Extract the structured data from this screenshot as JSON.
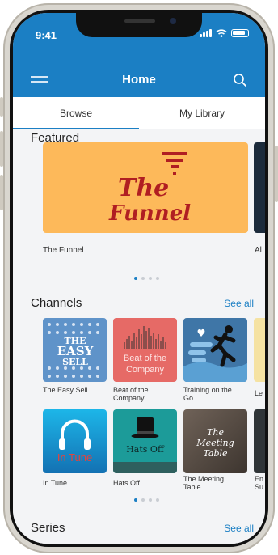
{
  "status": {
    "time": "9:41"
  },
  "header": {
    "title": "Home"
  },
  "tabs": [
    {
      "label": "Browse"
    },
    {
      "label": "My Library"
    }
  ],
  "featured": {
    "heading": "Featured",
    "items": [
      {
        "label": "The Funnel"
      },
      {
        "label": "Al"
      }
    ],
    "art": {
      "word1": "The",
      "word2": "Funnel"
    }
  },
  "channels": {
    "heading": "Channels",
    "see_all": "See all",
    "row1": [
      {
        "label": "The Easy Sell",
        "art": [
          "THE",
          "EASY",
          "SELL"
        ]
      },
      {
        "label": "Beat of the Company",
        "art": "Beat of the Company"
      },
      {
        "label": "Training on the Go"
      },
      {
        "label": "Le"
      }
    ],
    "row2": [
      {
        "label": "In Tune",
        "art": "In Tune"
      },
      {
        "label": "Hats Off",
        "art": "Hats Off"
      },
      {
        "label": "The Meeting Table",
        "art": "The Meeting Table"
      },
      {
        "label": "En Su"
      }
    ]
  },
  "series": {
    "heading": "Series",
    "see_all": "See all"
  },
  "colors": {
    "brand": "#1b7fc4",
    "featured_bg": "#fdb95a",
    "funnel_text": "#b01e22"
  }
}
